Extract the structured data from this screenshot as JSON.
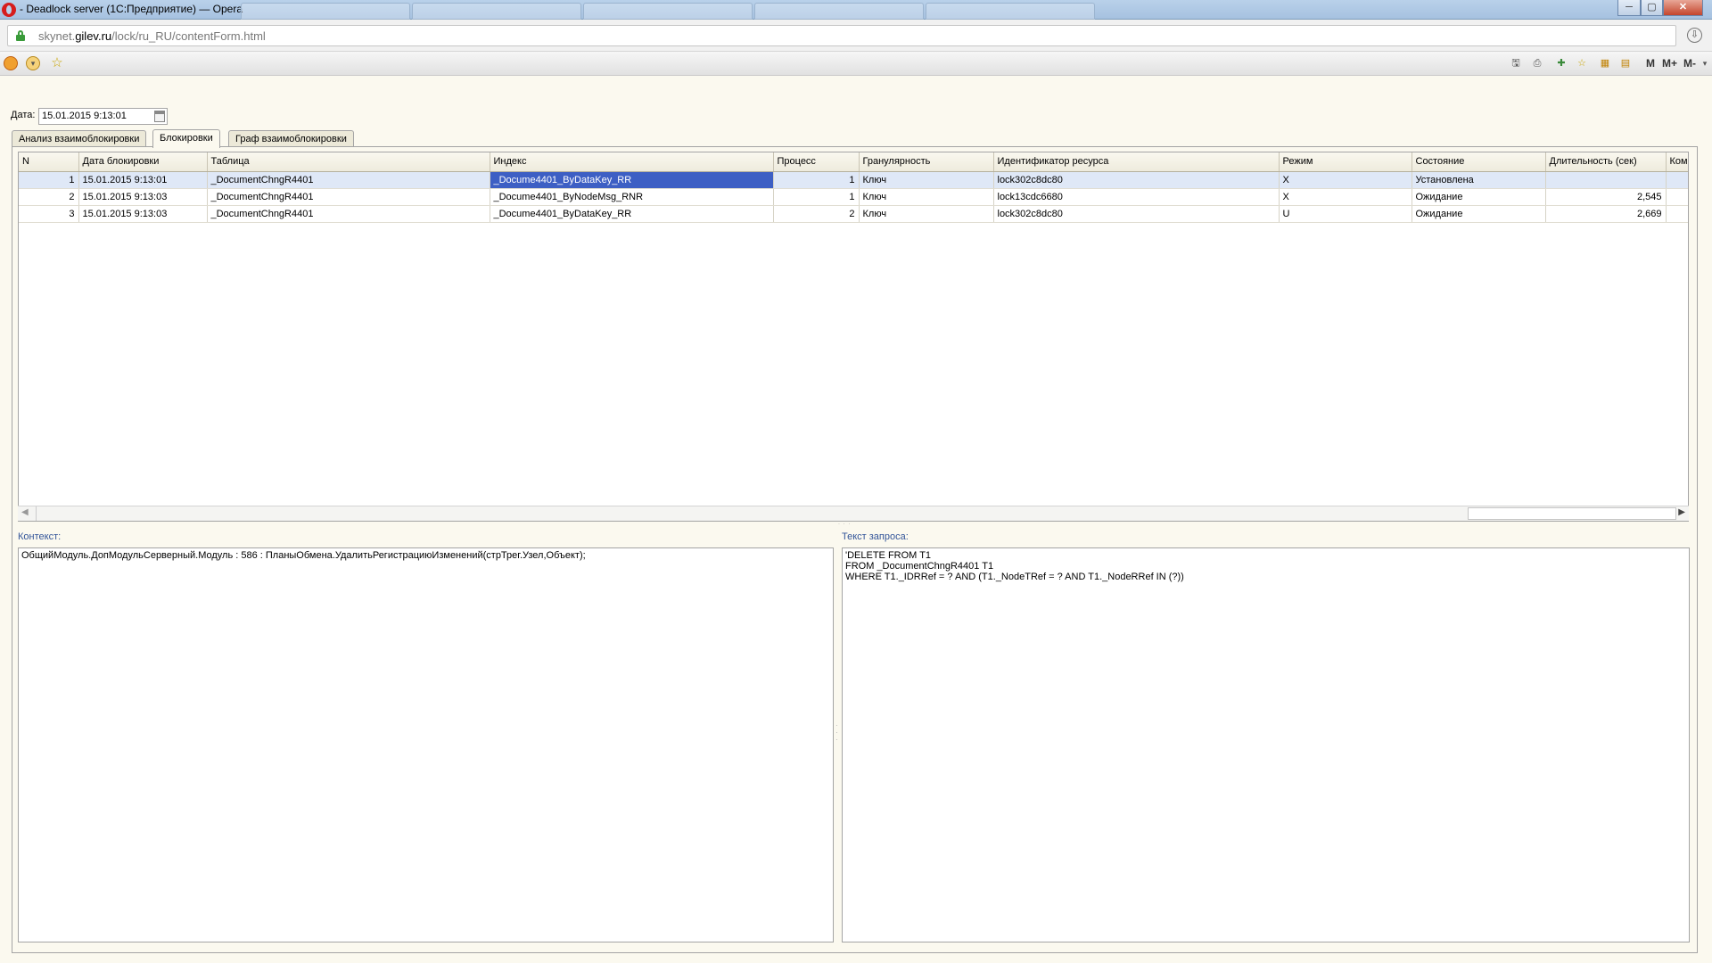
{
  "window": {
    "title": "- Deadlock server (1С:Предприятие) — Opera",
    "buttons": {
      "minimize": "─",
      "maximize": "▢",
      "close": "✕"
    }
  },
  "address_bar": {
    "url_prefix": "skynet.",
    "url_host": "gilev.ru",
    "url_path": "/lock/ru_RU/contentForm.html"
  },
  "toolbar": {
    "memory_buttons": [
      "M",
      "M+",
      "M-"
    ]
  },
  "form": {
    "date_label": "Дата:",
    "date_value": "15.01.2015  9:13:01",
    "tabs": [
      {
        "label": "Анализ взаимоблокировки",
        "active": false
      },
      {
        "label": "Блокировки",
        "active": true
      },
      {
        "label": "Граф взаимоблокировки",
        "active": false
      }
    ],
    "table": {
      "columns": [
        "N",
        "Дата блокировки",
        "Таблица",
        "Индекс",
        "Процесс",
        "Гранулярность",
        "Идентификатор ресурса",
        "Режим",
        "Состояние",
        "Длительность (сек)",
        "Комм"
      ],
      "rows": [
        [
          "1",
          "15.01.2015 9:13:01",
          "_DocumentChngR4401",
          "_Docume4401_ByDataKey_RR",
          "1",
          "Ключ",
          "lock302c8dc80",
          "X",
          "Установлена",
          "",
          ""
        ],
        [
          "2",
          "15.01.2015 9:13:03",
          "_DocumentChngR4401",
          "_Docume4401_ByNodeMsg_RNR",
          "1",
          "Ключ",
          "lock13cdc6680",
          "X",
          "Ожидание",
          "2,545",
          ""
        ],
        [
          "3",
          "15.01.2015 9:13:03",
          "_DocumentChngR4401",
          "_Docume4401_ByDataKey_RR",
          "2",
          "Ключ",
          "lock302c8dc80",
          "U",
          "Ожидание",
          "2,669",
          ""
        ]
      ]
    },
    "context_label": "Контекст:",
    "context_text": "ОбщийМодуль.ДопМодульСерверный.Модуль : 586 : ПланыОбмена.УдалитьРегистрациюИзменений(стрТрег.Узел,Объект);",
    "query_label": "Текст запроса:",
    "query_text": "'DELETE FROM T1\nFROM _DocumentChngR4401 T1\nWHERE T1._IDRRef = ? AND (T1._NodeTRef = ? AND T1._NodeRRef IN (?))"
  }
}
